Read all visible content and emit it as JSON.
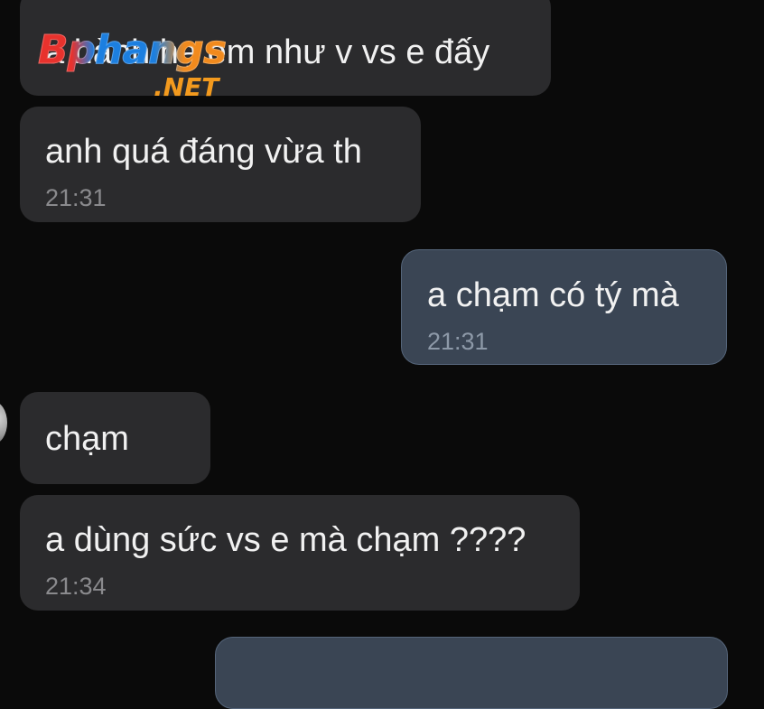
{
  "watermark": {
    "main": "Bphangs",
    "sub": ".NET"
  },
  "messages": [
    {
      "direction": "incoming",
      "text": "a hành hạ em như v vs e đấy",
      "time": ""
    },
    {
      "direction": "incoming",
      "text": "anh quá đáng vừa th",
      "time": "21:31"
    },
    {
      "direction": "outgoing",
      "text": "a chạm có tý mà",
      "time": "21:31"
    },
    {
      "direction": "incoming",
      "text": "chạm",
      "time": ""
    },
    {
      "direction": "incoming",
      "text": "a dùng sức vs e mà chạm ????",
      "time": "21:34"
    },
    {
      "direction": "outgoing",
      "text": "",
      "time": ""
    }
  ],
  "colors": {
    "background": "#0a0a0a",
    "incoming_bubble": "#2b2b2d",
    "outgoing_bubble": "#3a4554",
    "timestamp": "#8a8a8d"
  }
}
